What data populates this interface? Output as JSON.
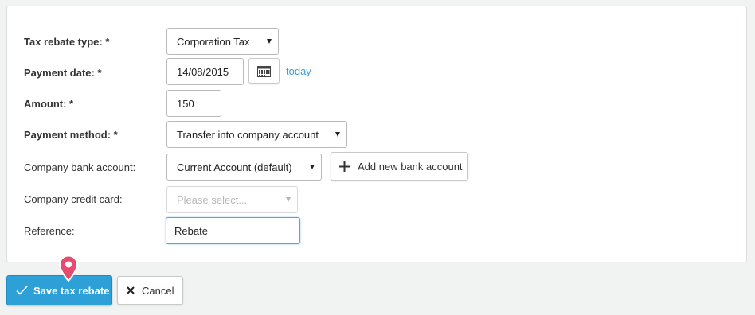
{
  "form": {
    "tax_rebate_type": {
      "label": "Tax rebate type: *",
      "value": "Corporation Tax"
    },
    "payment_date": {
      "label": "Payment date: *",
      "value": "14/08/2015",
      "today_link": "today"
    },
    "amount": {
      "label": "Amount: *",
      "value": "150"
    },
    "payment_method": {
      "label": "Payment method: *",
      "value": "Transfer into company account"
    },
    "company_bank_account": {
      "label": "Company bank account:",
      "value": "Current Account (default)",
      "add_button": "Add new bank account"
    },
    "company_credit_card": {
      "label": "Company credit card:",
      "placeholder": "Please select..."
    },
    "reference": {
      "label": "Reference:",
      "value": "Rebate"
    }
  },
  "actions": {
    "save_label": "Save tax rebate",
    "cancel_label": "Cancel"
  },
  "colors": {
    "accent": "#2ea0d8",
    "link": "#3aa0d9",
    "pin": "#e64a6e"
  },
  "icons": [
    "calendar-icon",
    "plus-icon",
    "check-icon",
    "close-icon",
    "location-pin-icon",
    "dropdown-caret-icon"
  ]
}
